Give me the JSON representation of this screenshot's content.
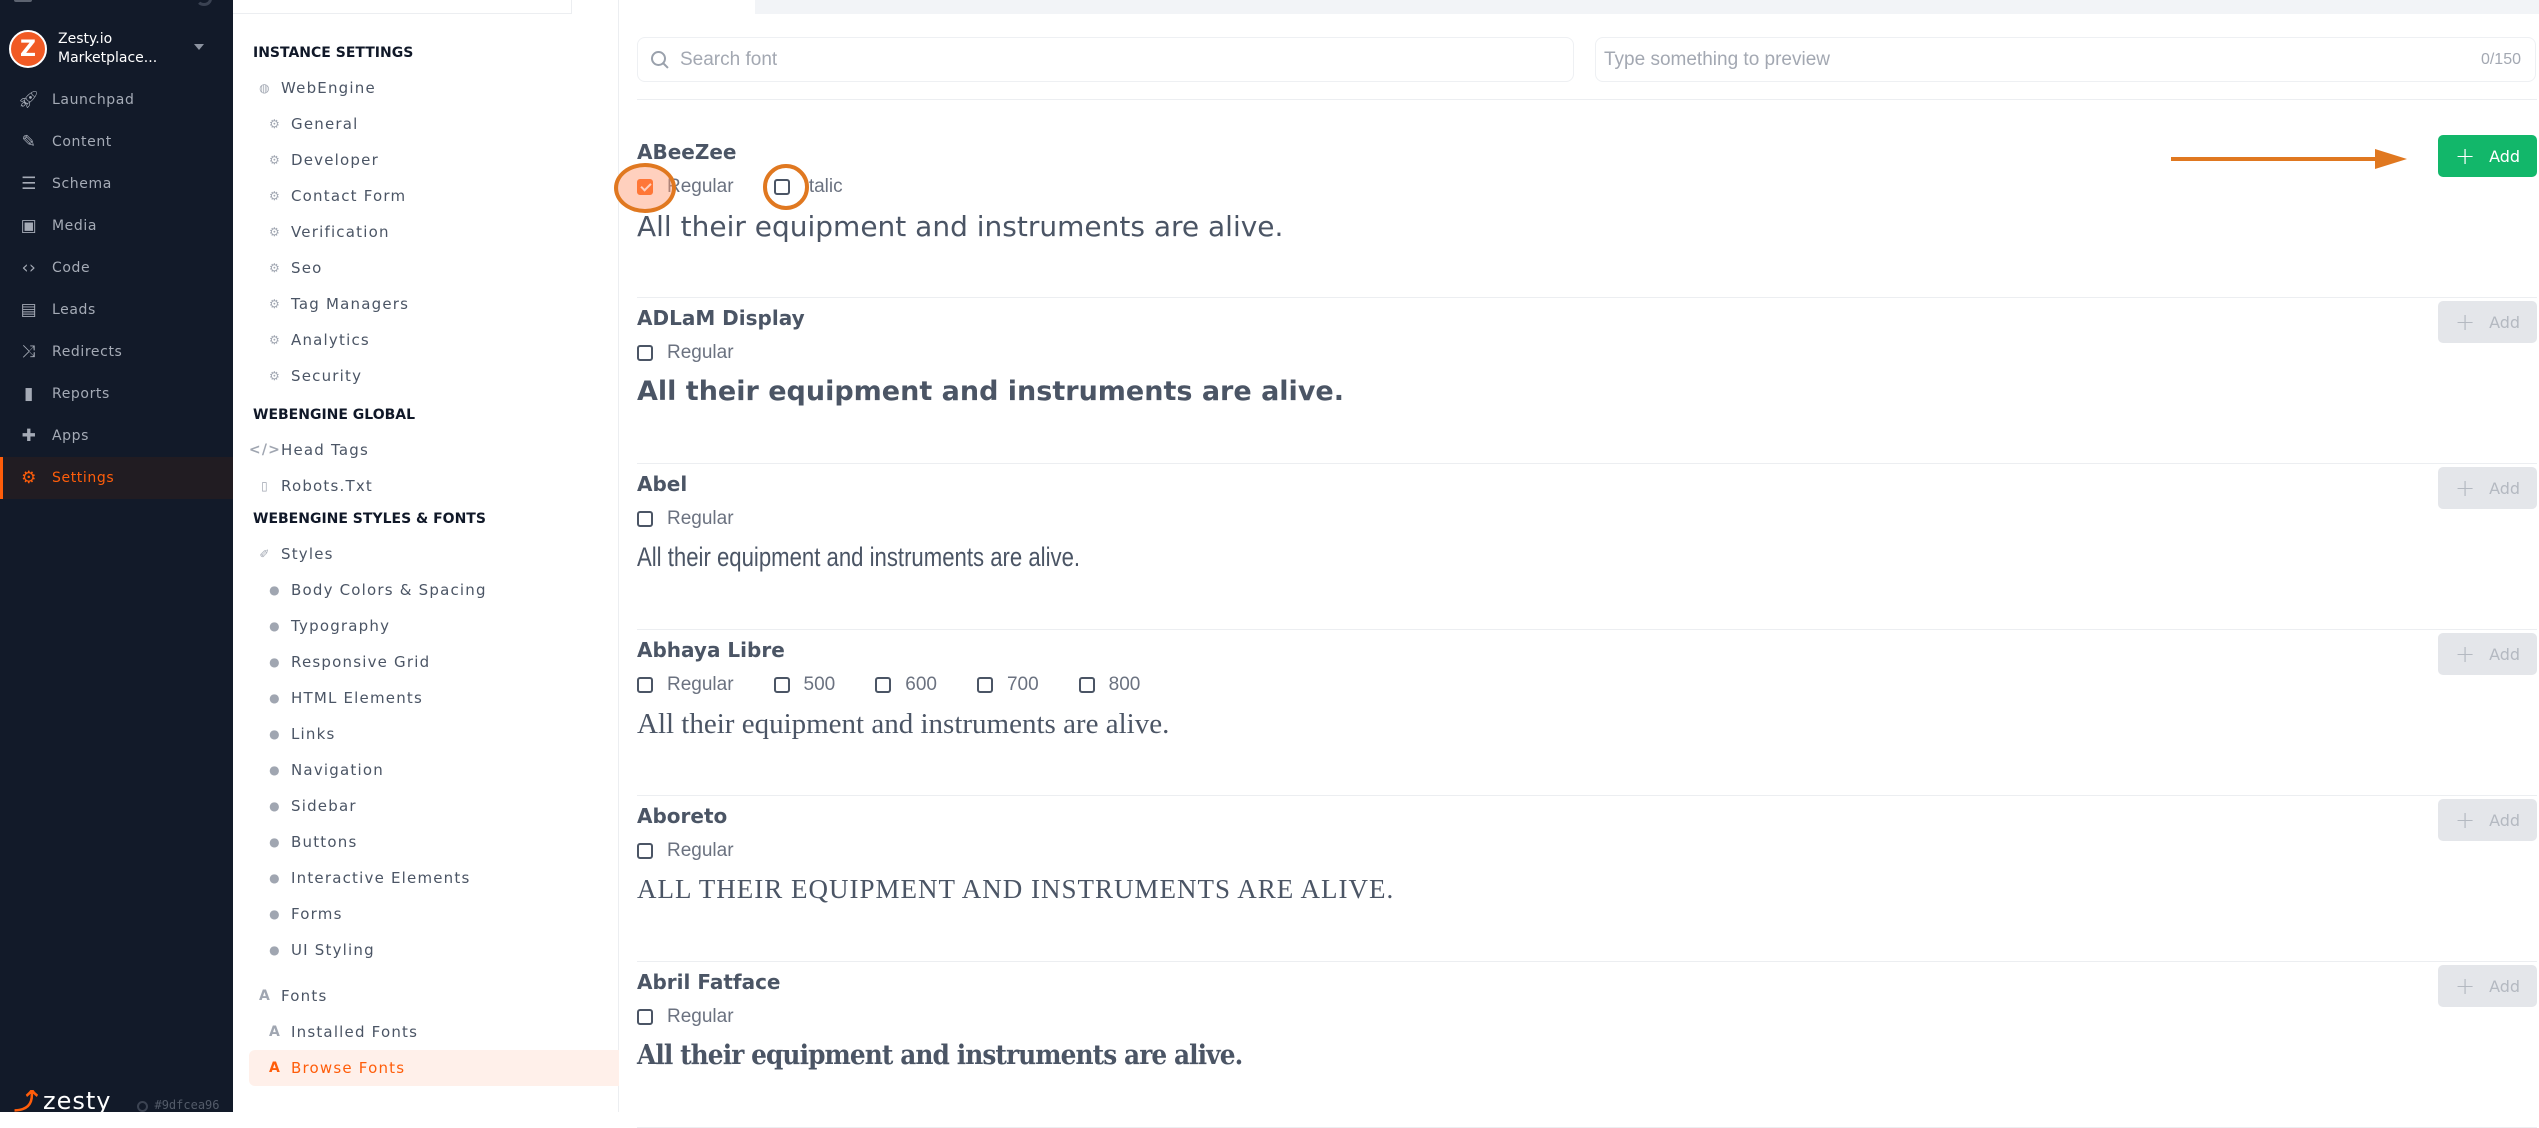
{
  "app": {
    "instance_name_line1": "Zesty.io",
    "instance_name_line2": "Marketplace...",
    "brand": "zesty",
    "build_hash": "#9dfcea96",
    "accent_color": "#ff5d0a"
  },
  "nav": {
    "items": [
      {
        "label": "Launchpad",
        "icon": "rocket-icon"
      },
      {
        "label": "Content",
        "icon": "pencil-icon"
      },
      {
        "label": "Schema",
        "icon": "database-icon"
      },
      {
        "label": "Media",
        "icon": "image-icon"
      },
      {
        "label": "Code",
        "icon": "code-icon"
      },
      {
        "label": "Leads",
        "icon": "contact-card-icon"
      },
      {
        "label": "Redirects",
        "icon": "shuffle-icon"
      },
      {
        "label": "Reports",
        "icon": "bar-chart-icon"
      },
      {
        "label": "Apps",
        "icon": "puzzle-icon"
      },
      {
        "label": "Settings",
        "icon": "gear-icon",
        "active": true
      }
    ]
  },
  "settings_nav": {
    "instance_settings": {
      "heading": "INSTANCE SETTINGS",
      "group": "WebEngine",
      "items": [
        "General",
        "Developer",
        "Contact Form",
        "Verification",
        "Seo",
        "Tag Managers",
        "Analytics",
        "Security"
      ]
    },
    "webengine_global": {
      "heading": "WEBENGINE GLOBAL",
      "items": [
        "Head Tags",
        "Robots.Txt"
      ]
    },
    "styles_fonts": {
      "heading": "WEBENGINE STYLES & FONTS",
      "styles_group": "Styles",
      "styles_items": [
        "Body Colors & Spacing",
        "Typography",
        "Responsive Grid",
        "HTML Elements",
        "Links",
        "Navigation",
        "Sidebar",
        "Buttons",
        "Interactive Elements",
        "Forms",
        "UI Styling"
      ],
      "fonts_group": "Fonts",
      "fonts_items": [
        "Installed Fonts",
        "Browse Fonts"
      ],
      "active_item": "Browse Fonts"
    }
  },
  "main": {
    "search_placeholder": "Search font",
    "preview_placeholder": "Type something to preview",
    "preview_counter": "0/150",
    "add_label": "Add",
    "fonts": [
      {
        "name": "ABeeZee",
        "variants": [
          {
            "label": "Regular",
            "checked": true
          },
          {
            "label": "Italic",
            "checked": false
          }
        ],
        "sample": "All their equipment and instruments are alive.",
        "add_enabled": true
      },
      {
        "name": "ADLaM Display",
        "variants": [
          {
            "label": "Regular",
            "checked": false
          }
        ],
        "sample": "All their equipment and instruments are alive.",
        "add_enabled": false
      },
      {
        "name": "Abel",
        "variants": [
          {
            "label": "Regular",
            "checked": false
          }
        ],
        "sample": "All their equipment and instruments are alive.",
        "add_enabled": false
      },
      {
        "name": "Abhaya Libre",
        "variants": [
          {
            "label": "Regular",
            "checked": false
          },
          {
            "label": "500",
            "checked": false
          },
          {
            "label": "600",
            "checked": false
          },
          {
            "label": "700",
            "checked": false
          },
          {
            "label": "800",
            "checked": false
          }
        ],
        "sample": "All their equipment and instruments are alive.",
        "add_enabled": false
      },
      {
        "name": "Aboreto",
        "variants": [
          {
            "label": "Regular",
            "checked": false
          }
        ],
        "sample": "All their equipment and instruments are alive.",
        "add_enabled": false
      },
      {
        "name": "Abril Fatface",
        "variants": [
          {
            "label": "Regular",
            "checked": false
          }
        ],
        "sample": "All their equipment and instruments are alive.",
        "add_enabled": false
      }
    ]
  }
}
